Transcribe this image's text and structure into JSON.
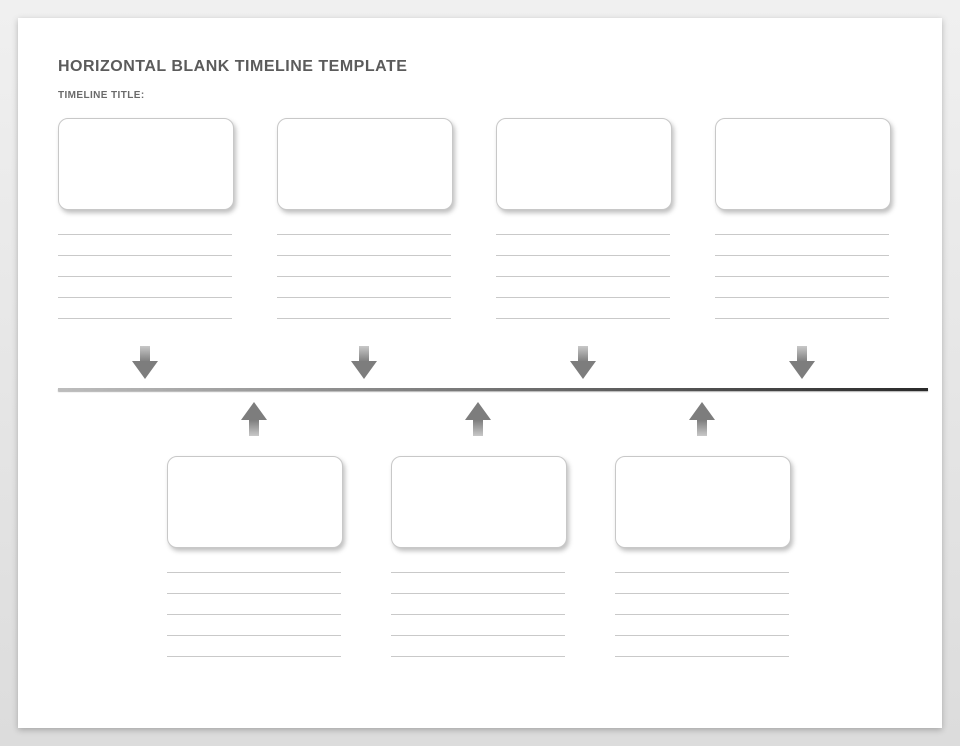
{
  "heading": "HORIZONTAL BLANK TIMELINE TEMPLATE",
  "subtitle": "TIMELINE TITLE:",
  "top_events": [
    {
      "box_text": "",
      "detail_lines": [
        "",
        "",
        "",
        "",
        ""
      ]
    },
    {
      "box_text": "",
      "detail_lines": [
        "",
        "",
        "",
        "",
        ""
      ]
    },
    {
      "box_text": "",
      "detail_lines": [
        "",
        "",
        "",
        "",
        ""
      ]
    },
    {
      "box_text": "",
      "detail_lines": [
        "",
        "",
        "",
        "",
        ""
      ]
    }
  ],
  "bottom_events": [
    {
      "box_text": "",
      "detail_lines": [
        "",
        "",
        "",
        "",
        ""
      ]
    },
    {
      "box_text": "",
      "detail_lines": [
        "",
        "",
        "",
        "",
        ""
      ]
    },
    {
      "box_text": "",
      "detail_lines": [
        "",
        "",
        "",
        "",
        ""
      ]
    }
  ]
}
